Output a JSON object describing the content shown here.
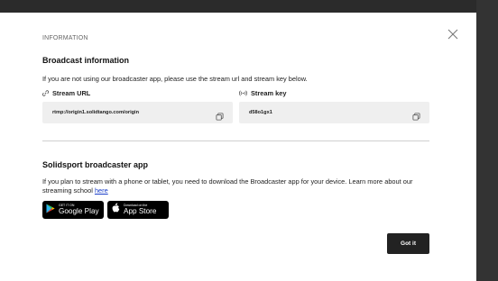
{
  "dialog": {
    "eyebrow": "INFORMATION",
    "close_icon": "close-icon"
  },
  "broadcast_info": {
    "title": "Broadcast information",
    "description": "If you are not using our broadcaster app, please use the stream url and stream key below.",
    "stream_url": {
      "label": "Stream URL",
      "icon": "link-icon",
      "value": "rtmp://origin1.solidtango.com/origin",
      "copy_icon": "copy-icon"
    },
    "stream_key": {
      "label": "Stream key",
      "icon": "broadcast-icon",
      "value": "d58o1gx1",
      "copy_icon": "copy-icon"
    }
  },
  "broadcaster_app": {
    "title": "Solidsport broadcaster app",
    "description": "If you plan to stream with a phone or tablet, you need to download the Broadcaster app for your device. Learn more about our streaming school",
    "link_text": "here",
    "google_play": {
      "small_text": "GET IT ON",
      "big_text": "Google Play",
      "icon": "google-play-icon"
    },
    "app_store": {
      "small_text": "Download on the",
      "big_text": "App Store",
      "icon": "apple-icon"
    }
  },
  "footer": {
    "got_it_label": "Got it"
  },
  "colors": {
    "backdrop": "#2b2b2b",
    "field_bg": "#efefef",
    "primary_button": "#222222",
    "link": "#1a3fc9"
  }
}
